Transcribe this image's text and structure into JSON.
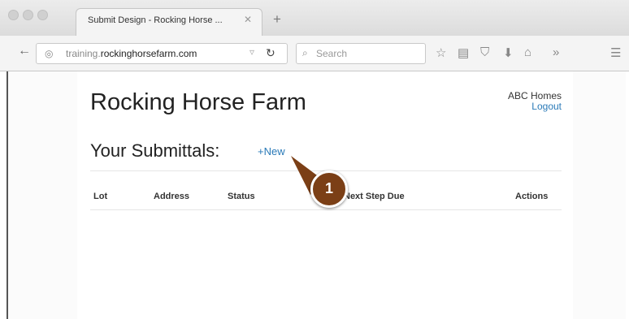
{
  "browser": {
    "tab_title": "Submit Design - Rocking Horse ...",
    "url_prefix": "training.",
    "url_domain": "rockinghorsefarm.com",
    "search_placeholder": "Search"
  },
  "site": {
    "brand": "Rocking Horse Farm",
    "user_name": "ABC Homes",
    "logout_label": "Logout"
  },
  "submittals": {
    "heading": "Your Submittals:",
    "new_label": "+New",
    "columns": [
      "Lot",
      "Address",
      "Status",
      "Next Step Due",
      "Actions"
    ]
  },
  "annotation": {
    "step_number": "1",
    "color": "#7b3f16"
  }
}
